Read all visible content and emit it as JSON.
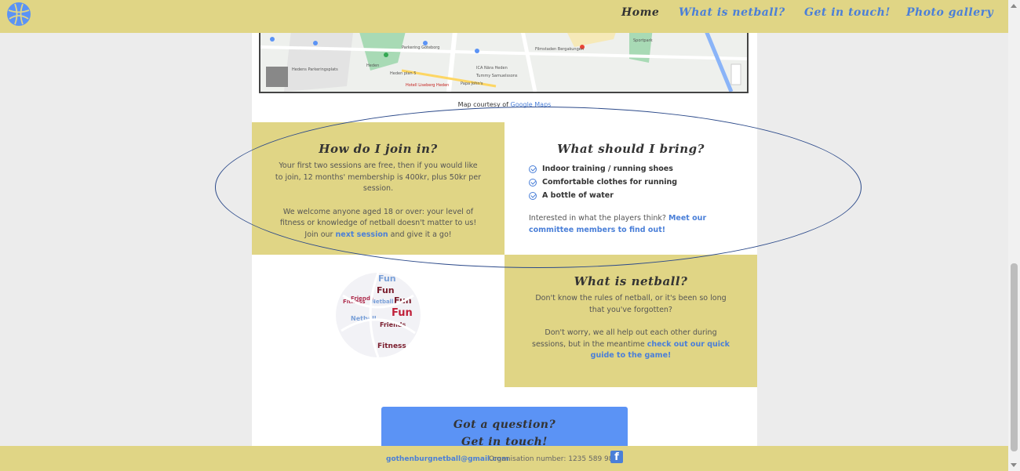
{
  "nav": {
    "items": [
      {
        "label": "Home",
        "active": true
      },
      {
        "label": "What is netball?"
      },
      {
        "label": "Get in touch!"
      },
      {
        "label": "Photo gallery"
      }
    ]
  },
  "map": {
    "labels": [
      "Parkering Göteborg",
      "Hedens Parkeringsplats",
      "ICA Nära Heden",
      "Tummy Samuelssons",
      "Papa John's",
      "Hotell Liseberg Heden",
      "Filmstaden Bergakungen",
      "Heden plan 5",
      "Heden",
      "Sportpark"
    ],
    "credit_prefix": "Map courtesy of ",
    "credit_link": "Google Maps"
  },
  "join": {
    "title": "How do I join in?",
    "p1": "Your first two sessions are free, then if you would like to join, 12 months' membership is 400kr, plus 50kr per session.",
    "p2_before": "We welcome anyone aged 18 or over: your level of fitness or knowledge of netball doesn't matter to us! Join our ",
    "p2_link": "next session",
    "p2_after": " and give it a go!"
  },
  "bring": {
    "title": "What should I bring?",
    "items": [
      "Indoor training / running shoes",
      "Comfortable clothes for running",
      "A bottle of water"
    ],
    "q_before": "Interested in what the players think? ",
    "q_link": "Meet our committee members to find out!"
  },
  "netball": {
    "title": "What is netball?",
    "p1": "Don't know the rules of netball, or it's been so long that you've forgotten?",
    "p2_before": "Don't worry, we all help out each other during sessions, but in the meantime ",
    "p2_link": "check out our quick guide to the game!",
    "wordcloud": [
      "Fun",
      "Fun",
      "Friends",
      "Netball",
      "Fitness",
      "Fitness",
      "Friends",
      "Fun",
      "Netball",
      "Fun"
    ]
  },
  "cta": {
    "line1": "Got a question?",
    "line2": "Get in touch!"
  },
  "footer": {
    "email": "gothenburgnetball@gmail.com",
    "org": "Organisation number: 1235 589 987"
  },
  "colors": {
    "accent": "#4a7fd8",
    "panel": "#e0d585",
    "cta": "#5b93f5"
  }
}
